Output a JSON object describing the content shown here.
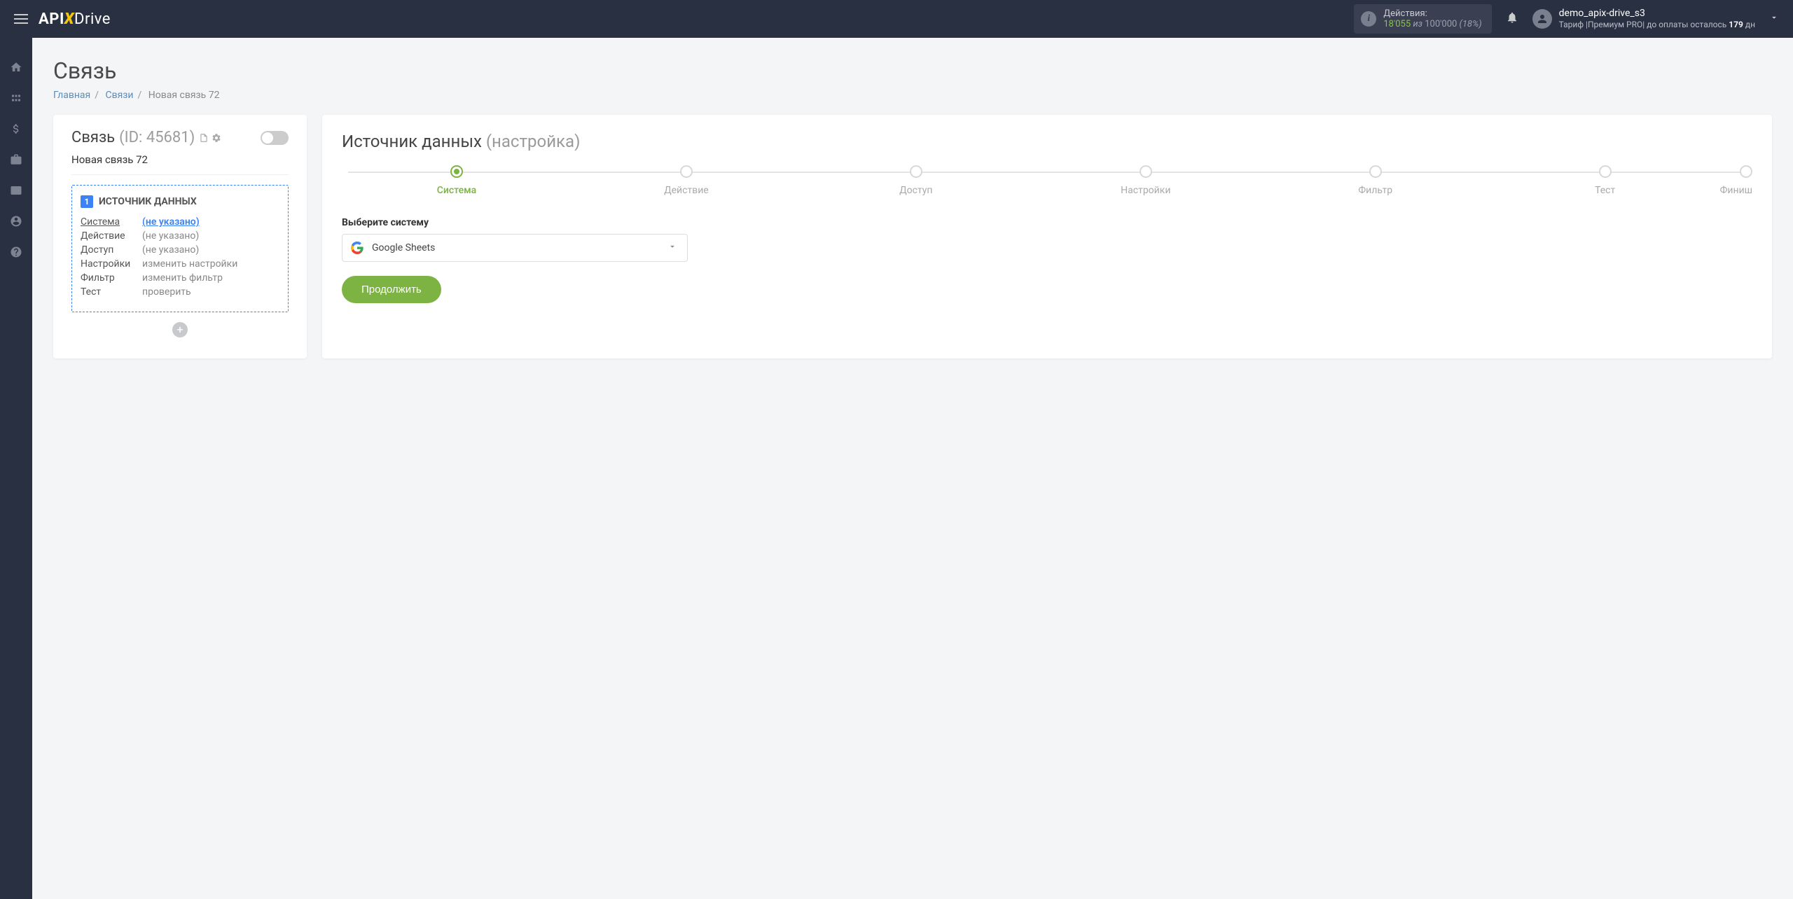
{
  "header": {
    "actions_label": "Действия:",
    "actions_current": "18'055",
    "actions_of": " из ",
    "actions_max": "100'000",
    "actions_pct": " (18%)",
    "user_name": "demo_apix-drive_s3",
    "tariff_prefix": "Тариф |Премиум PRO| до оплаты осталось ",
    "tariff_days": "179",
    "tariff_suffix": " дн"
  },
  "page": {
    "title": "Связь",
    "bc_home": "Главная",
    "bc_links": "Связи",
    "bc_current": "Новая связь 72"
  },
  "left": {
    "title_label": "Связь",
    "title_id": "(ID: 45681)",
    "conn_name": "Новая связь 72",
    "box_badge": "1",
    "box_title": "ИСТОЧНИК ДАННЫХ",
    "rows": {
      "system_k": "Система",
      "system_v": "(не указано)",
      "action_k": "Действие",
      "action_v": "(не указано)",
      "access_k": "Доступ",
      "access_v": "(не указано)",
      "settings_k": "Настройки",
      "settings_v": "изменить настройки",
      "filter_k": "Фильтр",
      "filter_v": "изменить фильтр",
      "test_k": "Тест",
      "test_v": "проверить"
    }
  },
  "right": {
    "title_main": "Источник данных",
    "title_sub": "(настройка)",
    "steps": {
      "s1": "Система",
      "s2": "Действие",
      "s3": "Доступ",
      "s4": "Настройки",
      "s5": "Фильтр",
      "s6": "Тест",
      "s7": "Финиш"
    },
    "field_label": "Выберите систему",
    "select_value": "Google Sheets",
    "continue": "Продолжить"
  }
}
